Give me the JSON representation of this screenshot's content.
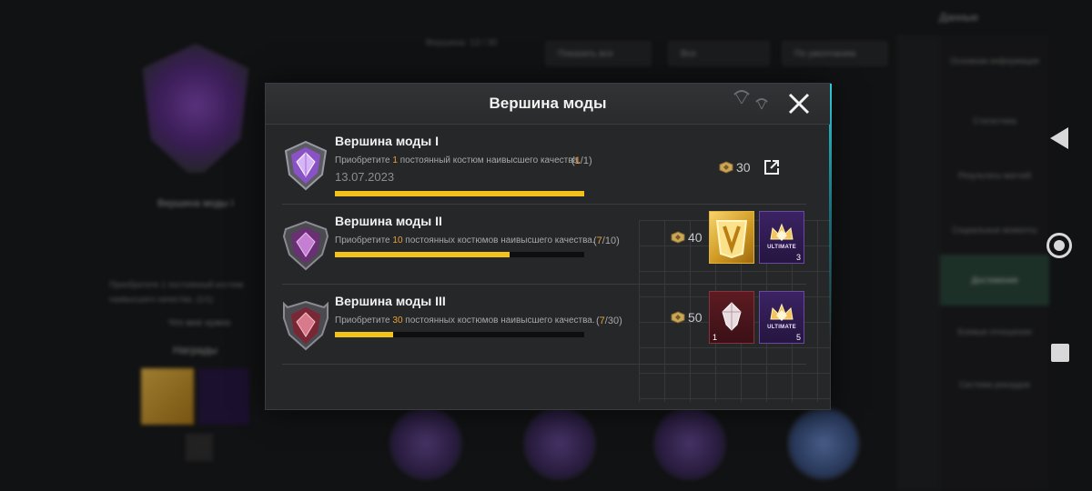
{
  "modal": {
    "title": "Вершина моды",
    "rows": [
      {
        "title": "Вершина моды I",
        "desc_pre": "Приобретите ",
        "desc_num": "1",
        "desc_post": " постоянный костюм наивысшего качества.",
        "progress_open": "(",
        "progress_current": "1",
        "progress_rest": "/1)",
        "date": "13.07.2023",
        "progress_fraction": 1.0,
        "points": "30",
        "badge_color": "#8b52c8"
      },
      {
        "title": "Вершина моды II",
        "desc_pre": "Приобретите ",
        "desc_num": "10",
        "desc_post": " постоянных костюмов наивысшего качества.",
        "progress_open": "(",
        "progress_current": "7",
        "progress_rest": "/10)",
        "progress_fraction": 0.7,
        "points": "40",
        "rewards": [
          {
            "type": "gold-frame",
            "qty": ""
          },
          {
            "type": "ultimate-crown",
            "label": "ULTIMATE",
            "qty": "3"
          }
        ],
        "badge_color": "#7a3a8a"
      },
      {
        "title": "Вершина моды III",
        "desc_pre": "Приобретите ",
        "desc_num": "30",
        "desc_post": " постоянных костюмов наивысшего качества.",
        "progress_open": "(",
        "progress_current": "7",
        "progress_rest": "/30)",
        "progress_fraction": 0.233,
        "points": "50",
        "rewards": [
          {
            "type": "red-crystal",
            "qty": "1"
          },
          {
            "type": "ultimate-crown",
            "label": "ULTIMATE",
            "qty": "5"
          }
        ],
        "badge_color": "#8a2c3c"
      }
    ]
  },
  "background": {
    "left_title": "Вершина моды I",
    "left_desc": "Приобретите 1 постоянный костюм наивысшего качества. (1/1)",
    "left_label": "Что мне нужно",
    "rewards_title": "Награды",
    "top_info": "Вершина: 13 / 30",
    "filters": [
      "Показать все",
      "Все",
      "По умолчанию"
    ],
    "top_right": "Данные",
    "menu": [
      "Основная информация",
      "Статистика",
      "Результаты матчей",
      "Социальные моменты",
      "Достижения",
      "Боевые отношения",
      "Система рекордов"
    ]
  }
}
